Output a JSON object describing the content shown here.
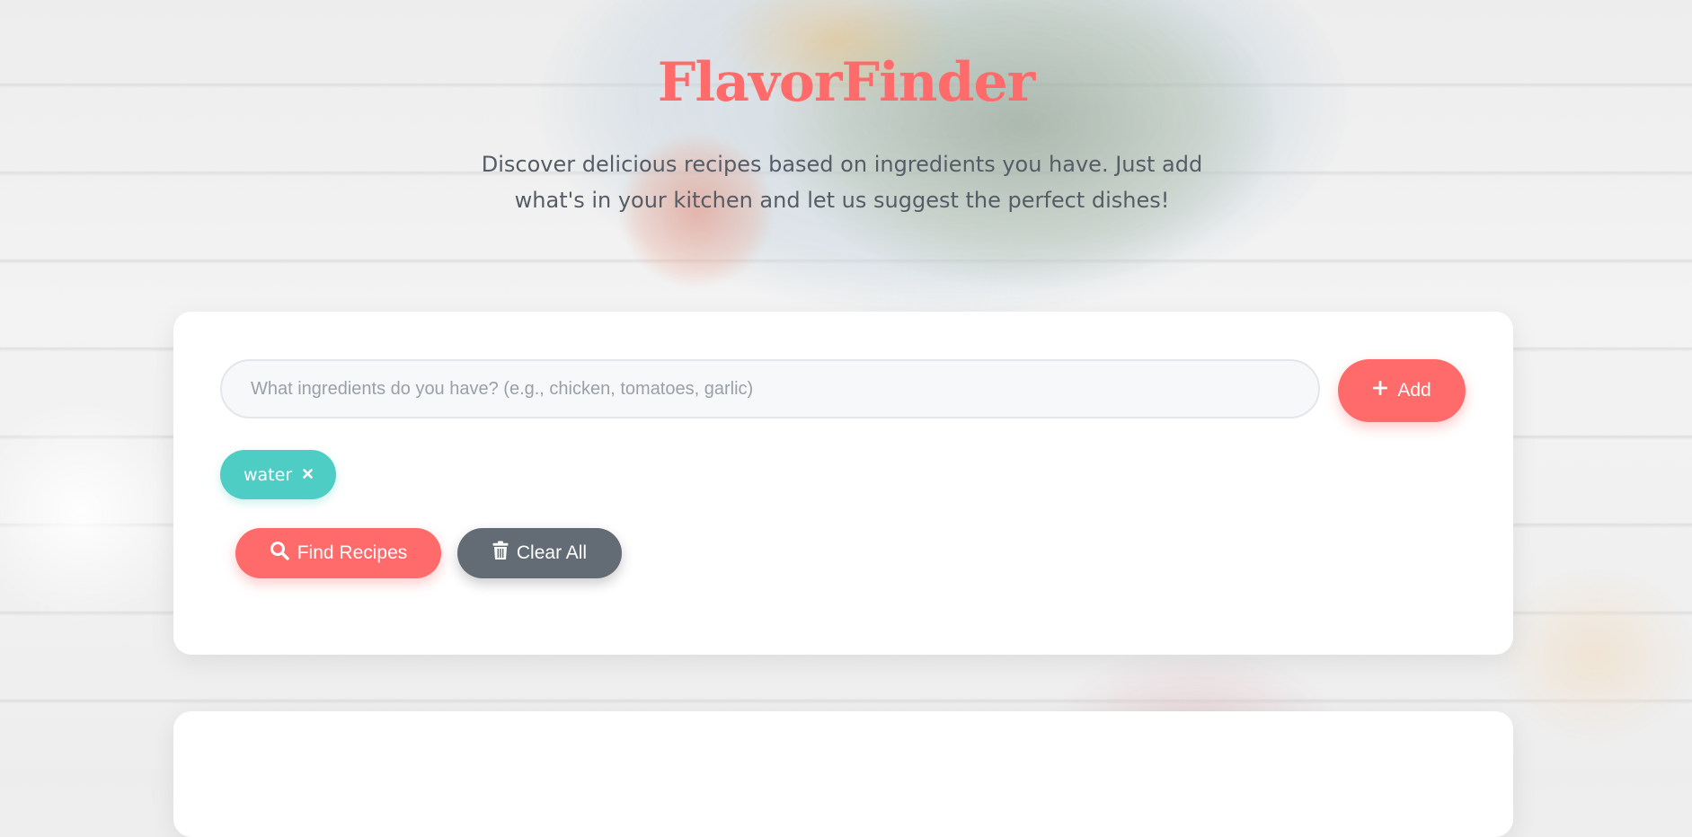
{
  "header": {
    "title": "FlavorFinder",
    "tagline": "Discover delicious recipes based on ingredients you have. Just add what's in your kitchen and let us suggest the perfect dishes!"
  },
  "search": {
    "placeholder": "What ingredients do you have? (e.g., chicken, tomatoes, garlic)",
    "value": "",
    "add_label": "Add",
    "add_icon": "plus-icon"
  },
  "ingredients": [
    {
      "label": "water",
      "remove_icon": "close-icon"
    }
  ],
  "actions": {
    "find_label": "Find Recipes",
    "find_icon": "search-icon",
    "clear_label": "Clear All",
    "clear_icon": "trash-icon"
  },
  "colors": {
    "accent": "#ff6b6b",
    "tag": "#4ecdc4",
    "secondary_button": "#636b75",
    "text_muted": "#555c66"
  }
}
